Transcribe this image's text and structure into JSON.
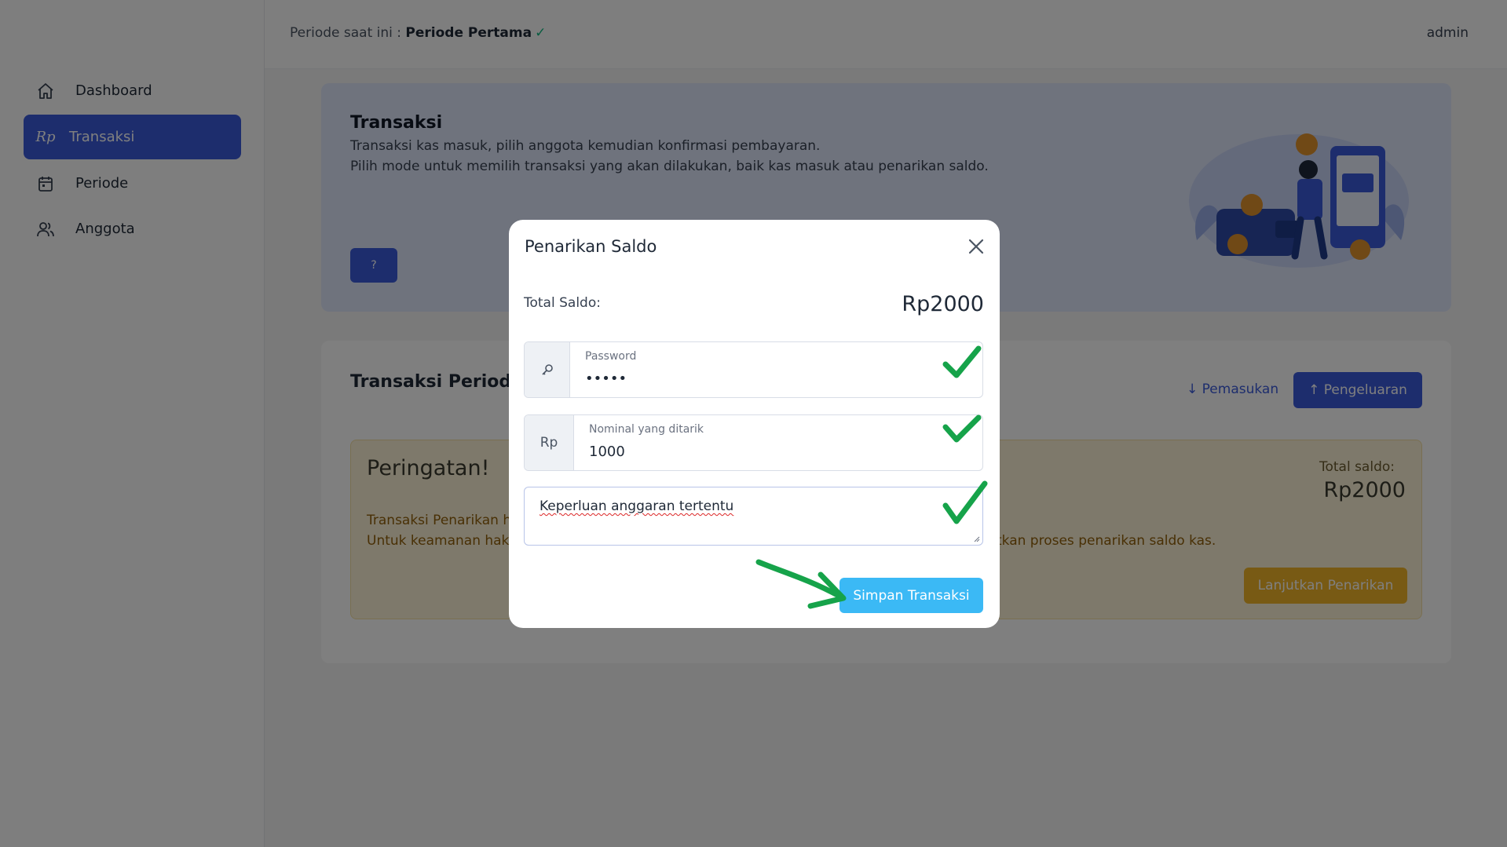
{
  "sidebar": {
    "items": [
      {
        "label": "Dashboard",
        "icon": "home-icon"
      },
      {
        "label": "Transaksi",
        "icon": "rupiah-icon",
        "icon_text": "Rp"
      },
      {
        "label": "Periode",
        "icon": "calendar-icon"
      },
      {
        "label": "Anggota",
        "icon": "users-icon"
      }
    ],
    "active_index": 1
  },
  "topbar": {
    "period_prefix": "Periode saat ini :",
    "period_name": "Periode Pertama",
    "period_check": "✓",
    "user": "admin"
  },
  "hero": {
    "title": "Transaksi",
    "line1": "Transaksi kas masuk, pilih anggota kemudian konfirmasi pembayaran.",
    "line2": "Pilih mode untuk memilih transaksi yang akan dilakukan, baik kas masuk atau penarikan saldo.",
    "help_label": "?"
  },
  "transactions": {
    "title": "Transaksi Periode P",
    "income_label": "↓ Pemasukan",
    "expense_label": "↑ Pengeluaran"
  },
  "warning": {
    "title": "Peringatan!",
    "line1": "Transaksi Penarikan ha",
    "line2": "Untuk keamanan hak a",
    "line2_tail": "tkan proses penarikan saldo kas.",
    "total_label": "Total saldo:",
    "total_value": "Rp2000",
    "continue_label": "Lanjutkan Penarikan"
  },
  "modal": {
    "title": "Penarikan Saldo",
    "total_label": "Total Saldo:",
    "total_value": "Rp2000",
    "password": {
      "label": "Password",
      "value": "•••••",
      "icon": "key-icon"
    },
    "nominal": {
      "addon": "Rp",
      "label": "Nominal yang ditarik",
      "value": "1000"
    },
    "purpose": {
      "value": "Keperluan anggaran tertentu"
    },
    "save_label": "Simpan Transaksi"
  },
  "colors": {
    "primary": "#3b5bdb",
    "save": "#3bb9f5",
    "warning_button": "#f0b429",
    "annotation_green": "#16a34a"
  }
}
